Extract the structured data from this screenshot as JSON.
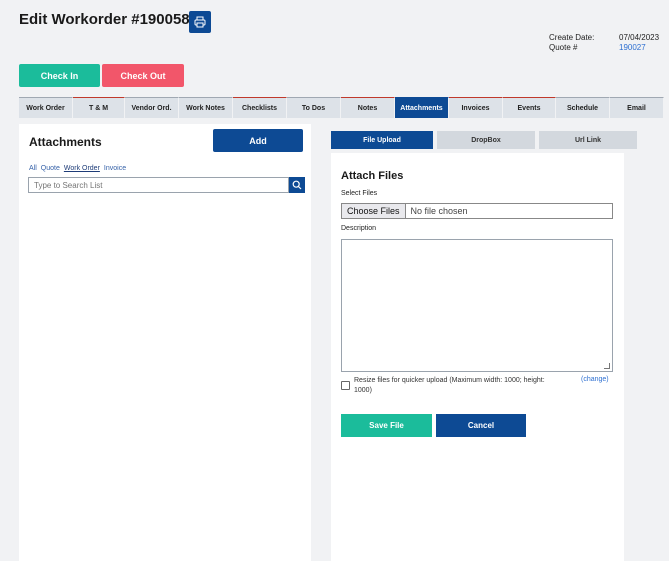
{
  "header": {
    "title": "Edit Workorder #190058",
    "print_icon": "printer-icon",
    "create_date_label": "Create Date:",
    "create_date_value": "07/04/2023",
    "quote_label": "Quote #",
    "quote_value": "190027"
  },
  "actions": {
    "check_in": "Check In",
    "check_out": "Check Out"
  },
  "tabs": [
    {
      "label": "Work Order",
      "red": false,
      "active": false
    },
    {
      "label": "T & M",
      "red": true,
      "active": false
    },
    {
      "label": "Vendor Ord.",
      "red": false,
      "active": false
    },
    {
      "label": "Work Notes",
      "red": false,
      "active": false
    },
    {
      "label": "Checklists",
      "red": true,
      "active": false
    },
    {
      "label": "To Dos",
      "red": false,
      "active": false
    },
    {
      "label": "Notes",
      "red": true,
      "active": false
    },
    {
      "label": "Attachments",
      "red": false,
      "active": true
    },
    {
      "label": "Invoices",
      "red": true,
      "active": false
    },
    {
      "label": "Events",
      "red": true,
      "active": false
    },
    {
      "label": "Schedule",
      "red": false,
      "active": false
    },
    {
      "label": "Email",
      "red": false,
      "active": false
    }
  ],
  "attachments": {
    "title": "Attachments",
    "add_label": "Add",
    "filters": [
      "All",
      "Quote",
      "Work Order",
      "Invoice"
    ],
    "selected_filter": "Work Order",
    "search_placeholder": "Type to Search List",
    "search_icon": "search-icon"
  },
  "upload_tabs": [
    {
      "label": "File Upload",
      "active": true
    },
    {
      "label": "DropBox",
      "active": false
    },
    {
      "label": "Url Link",
      "active": false
    }
  ],
  "attach_form": {
    "title": "Attach Files",
    "select_files_label": "Select Files",
    "choose_files_label": "Choose Files",
    "no_file_text": "No file chosen",
    "description_label": "Description",
    "resize_text": "Resize files for quicker upload (Maximum width: 1000; height: 1000)",
    "change_link": "(change)",
    "save_label": "Save File",
    "cancel_label": "Cancel"
  },
  "colors": {
    "primary": "#0d4a94",
    "success": "#1bbc9b",
    "danger": "#f2566a"
  }
}
